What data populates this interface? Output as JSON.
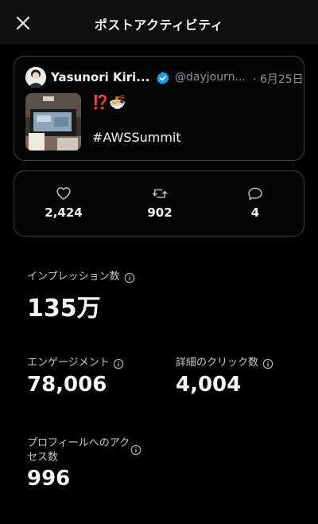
{
  "header": {
    "title": "ポストアクティビティ"
  },
  "post": {
    "author_name": "Yasunori Kiri...",
    "handle": "@dayjourn...",
    "separator": "·",
    "date": "6月25日",
    "emoji_text": "⁉️🍜",
    "hashtag": "#AWSSummit"
  },
  "engagement": {
    "likes": "2,424",
    "reposts": "902",
    "replies": "4"
  },
  "metrics": {
    "impressions": {
      "label": "インプレッション数",
      "value": "135万"
    },
    "engagements": {
      "label": "エンゲージメント",
      "value": "78,006"
    },
    "detail_clicks": {
      "label": "詳細のクリック数",
      "value": "4,004"
    },
    "profile_visits": {
      "label": "プロフィールへのアクセス数",
      "value": "996"
    }
  },
  "colors": {
    "background": "#000000",
    "verified": "#1d9bf0",
    "muted": "#8b9196"
  },
  "icons": [
    "close-icon",
    "verified-badge-icon",
    "heart-icon",
    "repost-icon",
    "reply-icon",
    "info-icon"
  ]
}
